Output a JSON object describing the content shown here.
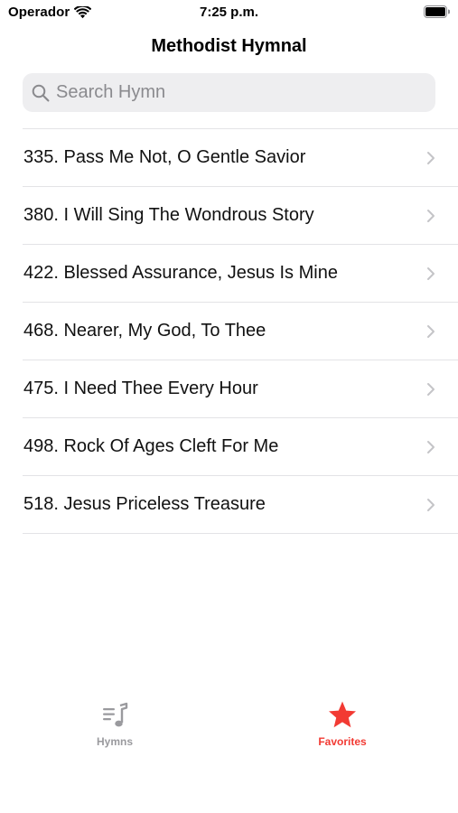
{
  "status_bar": {
    "carrier": "Operador",
    "time": "7:25 p.m.",
    "icons": [
      "wifi-icon",
      "battery-icon"
    ]
  },
  "nav": {
    "title": "Methodist Hymnal"
  },
  "search": {
    "placeholder": "Search Hymn",
    "value": "",
    "icon": "search-icon"
  },
  "hymns": [
    {
      "label": "335. Pass Me Not, O Gentle Savior"
    },
    {
      "label": "380. I Will Sing The Wondrous Story"
    },
    {
      "label": "422. Blessed Assurance, Jesus Is Mine"
    },
    {
      "label": "468. Nearer, My God, To Thee"
    },
    {
      "label": "475. I Need Thee Every Hour"
    },
    {
      "label": "498. Rock Of Ages Cleft For Me"
    },
    {
      "label": "518. Jesus Priceless Treasure"
    }
  ],
  "tab_bar": {
    "tabs": [
      {
        "label": "Hymns",
        "icon": "music-list-icon",
        "selected": false
      },
      {
        "label": "Favorites",
        "icon": "star-icon",
        "selected": true
      }
    ]
  },
  "colors": {
    "accent": "#f23a33",
    "inactive_tab": "#9a9a9e",
    "search_bg": "#eeeef0",
    "separator": "#e3e3e6",
    "chevron": "#c4c4c7"
  }
}
